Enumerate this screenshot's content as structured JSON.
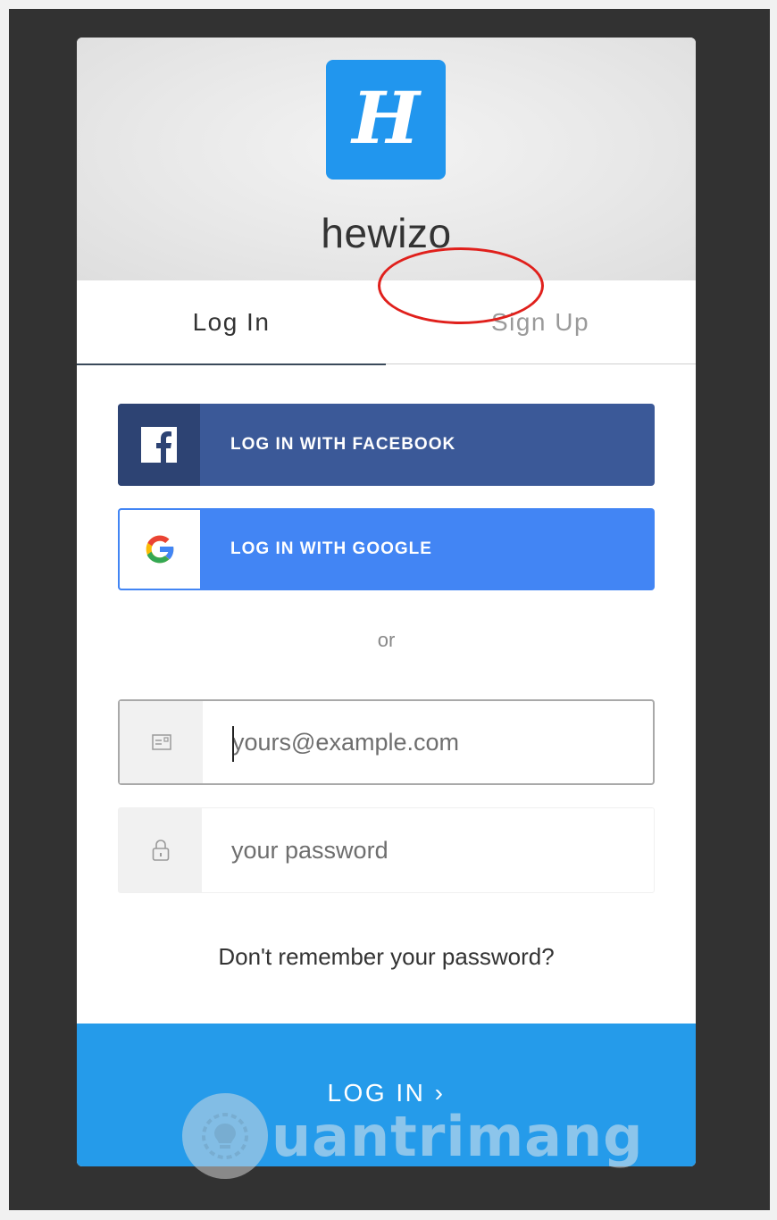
{
  "app": {
    "logo_letter": "H",
    "brand_name": "hewizo"
  },
  "tabs": [
    {
      "label": "Log In",
      "active": true
    },
    {
      "label": "Sign Up",
      "active": false,
      "highlighted": true
    }
  ],
  "social": {
    "facebook_label": "LOG IN WITH FACEBOOK",
    "google_label": "LOG IN WITH GOOGLE"
  },
  "divider_text": "or",
  "form": {
    "email_placeholder": "yours@example.com",
    "password_placeholder": "your password"
  },
  "forgot_password": "Don't remember your password?",
  "submit_label": "LOG IN ›",
  "watermark": "uantrimang",
  "colors": {
    "accent": "#259bea",
    "facebook": "#3b5998",
    "google": "#4285f4",
    "highlight_ring": "#e0201c"
  },
  "icons": {
    "facebook": "facebook-icon",
    "google": "google-icon",
    "email": "envelope-icon",
    "password": "lock-icon"
  }
}
